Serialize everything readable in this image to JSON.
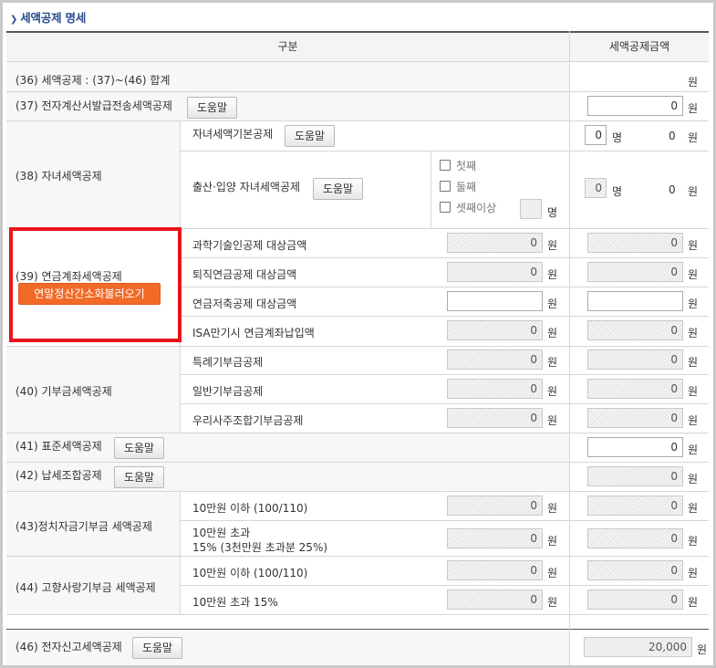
{
  "section": {
    "title": "세액공제 명세"
  },
  "header": {
    "category": "구분",
    "amount": "세액공제금액"
  },
  "rows": {
    "r36": {
      "label": "(36) 세액공제 : (37)~(46) 합계",
      "unit": "원"
    },
    "r37": {
      "label": "(37) 전자계산서발급전송세액공제",
      "help": "도움말",
      "value": "0",
      "unit": "원"
    },
    "r38": {
      "label": "(38) 자녀세액공제",
      "basic": {
        "label": "자녀세액기본공제",
        "help": "도움말",
        "count": "0",
        "count_unit": "명",
        "value": "0",
        "unit": "원"
      },
      "birth": {
        "label": "출산·입양 자녀세액공제",
        "help": "도움말",
        "opt1": "첫째",
        "opt2": "둘째",
        "opt3": "셋째이상",
        "opt3_unit": "명",
        "count": "0",
        "count_unit": "명",
        "value": "0",
        "unit": "원"
      }
    },
    "r39": {
      "label": "(39) 연금계좌세액공제",
      "import_btn": "연말정산간소화불러오기",
      "items": [
        {
          "label": "과학기술인공제 대상금액",
          "base": "0",
          "base_unit": "원",
          "value": "0",
          "unit": "원"
        },
        {
          "label": "퇴직연금공제 대상금액",
          "base": "0",
          "base_unit": "원",
          "value": "0",
          "unit": "원"
        },
        {
          "label": "연금저축공제 대상금액",
          "base": "",
          "base_unit": "원",
          "value": "",
          "unit": "원"
        },
        {
          "label": "ISA만기시 연금계좌납입액",
          "base": "0",
          "base_unit": "원",
          "value": "0",
          "unit": "원"
        }
      ]
    },
    "r40": {
      "label": "(40) 기부금세액공제",
      "items": [
        {
          "label": "특례기부금공제",
          "base": "0",
          "base_unit": "원",
          "value": "0",
          "unit": "원"
        },
        {
          "label": "일반기부금공제",
          "base": "0",
          "base_unit": "원",
          "value": "0",
          "unit": "원"
        },
        {
          "label": "우리사주조합기부금공제",
          "base": "0",
          "base_unit": "원",
          "value": "0",
          "unit": "원"
        }
      ]
    },
    "r41": {
      "label": "(41) 표준세액공제",
      "help": "도움말",
      "value": "0",
      "unit": "원"
    },
    "r42": {
      "label": "(42) 납세조합공제",
      "help": "도움말",
      "value": "0",
      "unit": "원"
    },
    "r43": {
      "label": "(43)정치자금기부금 세액공제",
      "items": [
        {
          "label": "10만원 이하 (100/110)",
          "base": "0",
          "base_unit": "원",
          "value": "0",
          "unit": "원"
        },
        {
          "label_line1": "10만원 초과",
          "label_line2": "15% (3천만원 초과분 25%)",
          "base": "0",
          "base_unit": "원",
          "value": "0",
          "unit": "원"
        }
      ]
    },
    "r44": {
      "label": "(44) 고향사랑기부금 세액공제",
      "items": [
        {
          "label": "10만원 이하 (100/110)",
          "base": "0",
          "base_unit": "원",
          "value": "0",
          "unit": "원"
        },
        {
          "label": "10만원 초과 15%",
          "base": "0",
          "base_unit": "원",
          "value": "0",
          "unit": "원"
        }
      ]
    },
    "r46": {
      "label": "(46) 전자신고세액공제",
      "help": "도움말",
      "value": "20,000",
      "unit": "원"
    }
  },
  "colors": {
    "title": "#2a4d8f",
    "highlight": "#e8141b",
    "import_btn": "#f26a28"
  }
}
